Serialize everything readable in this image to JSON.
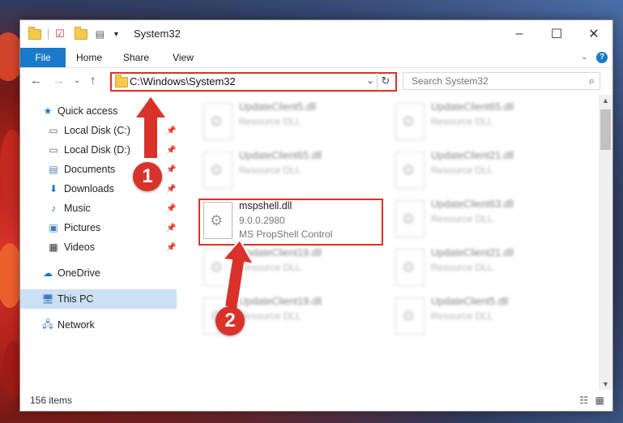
{
  "window": {
    "title": "System32",
    "minimize": "–",
    "maximize": "☐",
    "close": "✕"
  },
  "ribbon": {
    "tabs": [
      "File",
      "Home",
      "Share",
      "View"
    ],
    "help": "?"
  },
  "address": {
    "path": "C:\\Windows\\System32",
    "search_placeholder": "Search System32"
  },
  "sidebar": {
    "items": [
      {
        "label": "Quick access",
        "icon": "star-icon",
        "pinned": false
      },
      {
        "label": "Local Disk (C:)",
        "icon": "drive-icon",
        "pinned": true
      },
      {
        "label": "Local Disk (D:)",
        "icon": "drive-icon",
        "pinned": true
      },
      {
        "label": "Documents",
        "icon": "documents-icon",
        "pinned": true
      },
      {
        "label": "Downloads",
        "icon": "download-icon",
        "pinned": true
      },
      {
        "label": "Music",
        "icon": "music-icon",
        "pinned": true
      },
      {
        "label": "Pictures",
        "icon": "pictures-icon",
        "pinned": true
      },
      {
        "label": "Videos",
        "icon": "videos-icon",
        "pinned": true
      },
      {
        "label": "OneDrive",
        "icon": "cloud-icon",
        "pinned": false
      },
      {
        "label": "This PC",
        "icon": "computer-icon",
        "pinned": false
      },
      {
        "label": "Network",
        "icon": "network-icon",
        "pinned": false
      }
    ]
  },
  "files": {
    "highlighted": {
      "name": "mspshell.dll",
      "version": "9.0.0.2980",
      "description": "MS PropShell Control"
    },
    "blurred": [
      {
        "name": "UpdateClient5.dll",
        "description": "Resource DLL"
      },
      {
        "name": "UpdateClient65.dll",
        "description": "Resource DLL"
      },
      {
        "name": "UpdateClient65.dll",
        "description": "Resource DLL"
      },
      {
        "name": "UpdateClient21.dll",
        "description": "Resource DLL"
      },
      {
        "name": "UpdateClient63.dll",
        "description": "Resource DLL"
      },
      {
        "name": "UpdateClient19.dll",
        "description": "Resource DLL"
      },
      {
        "name": "UpdateClient21.dll",
        "description": "Resource DLL"
      },
      {
        "name": "UpdateClient19.dll",
        "description": "Resource DLL"
      },
      {
        "name": "UpdateClient5.dll",
        "description": "Resource DLL"
      }
    ]
  },
  "status": {
    "count": "156 items"
  },
  "annotations": {
    "step1": "1",
    "step2": "2",
    "color": "#d9322b"
  }
}
